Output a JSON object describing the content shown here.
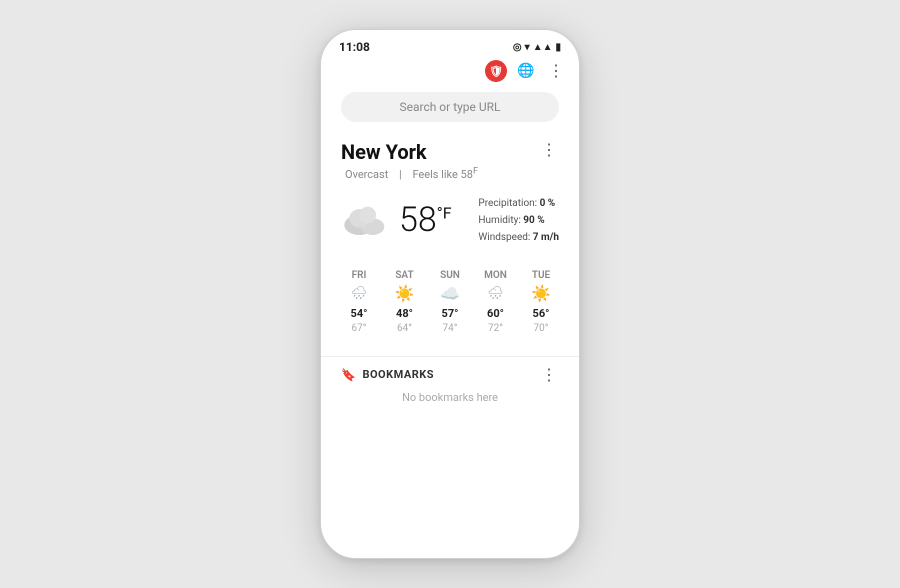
{
  "phone": {
    "statusBar": {
      "time": "11:08",
      "icons": [
        "eye",
        "wifi",
        "signal",
        "battery"
      ]
    },
    "toolbar": {
      "icon1": "🛡",
      "icon2": "🌐",
      "icon3": "⋮"
    },
    "searchBar": {
      "placeholder": "Search or type URL"
    },
    "weather": {
      "city": "New York",
      "condition": "Overcast",
      "feelsLike": "Feels like 58",
      "feelsUnit": "F",
      "temp": "58",
      "tempUnit": "F",
      "precipitation": "0 %",
      "humidity": "90 %",
      "windspeed": "7 m/h",
      "forecast": [
        {
          "day": "FRI",
          "icon": "rain",
          "low": "54°",
          "high": "67°"
        },
        {
          "day": "SAT",
          "icon": "sun",
          "low": "48°",
          "high": "64°"
        },
        {
          "day": "SUN",
          "icon": "cloud",
          "low": "57°",
          "high": "74°"
        },
        {
          "day": "MON",
          "icon": "rain",
          "low": "60°",
          "high": "72°"
        },
        {
          "day": "TUE",
          "icon": "sun",
          "low": "56°",
          "high": "70°"
        }
      ]
    },
    "bookmarks": {
      "title": "BOOKMARKS",
      "empty": "No bookmarks here"
    }
  }
}
